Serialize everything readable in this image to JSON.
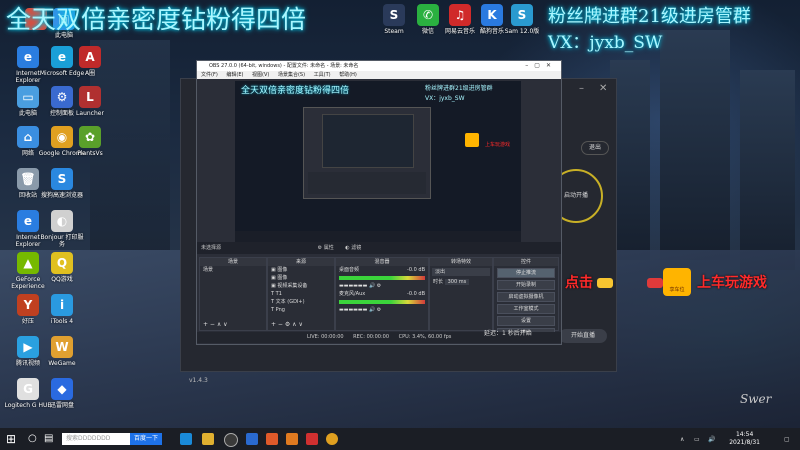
{
  "banners": {
    "main": "全天双倍亲密度钻粉得四倍",
    "top_right": "粉丝牌进群21级进房管群",
    "vx": "VX：jyxb_SW",
    "promo_prefix": "点击",
    "promo_suffix": "上车玩游戏",
    "coupon": "享车位"
  },
  "desktop_icons": [
    {
      "label": "",
      "color": "#e04a3a",
      "glyph": ""
    },
    {
      "label": "此电脑",
      "color": "#3c8ee8",
      "glyph": "▣"
    },
    {
      "label": "Internet Explorer",
      "color": "#2a7de0",
      "glyph": "e"
    },
    {
      "label": "Microsoft Edge",
      "color": "#1a9fd8",
      "glyph": "e"
    },
    {
      "label": "A圈",
      "color": "#c02a2a",
      "glyph": "A"
    },
    {
      "label": "此电脑",
      "color": "#4a9ee0",
      "glyph": "▭"
    },
    {
      "label": "控制面板",
      "color": "#3a6ad0",
      "glyph": "⚙"
    },
    {
      "label": "Launcher",
      "color": "#b03030",
      "glyph": "L"
    },
    {
      "label": "网络",
      "color": "#3a8ee0",
      "glyph": "⌂"
    },
    {
      "label": "Google Chrome",
      "color": "#e0a020",
      "glyph": "◉"
    },
    {
      "label": "PlantsVs",
      "color": "#5aa02a",
      "glyph": "✿"
    },
    {
      "label": "回收站",
      "color": "#8a9aaa",
      "glyph": "🗑"
    },
    {
      "label": "搜狗高速浏览器",
      "color": "#2a88e0",
      "glyph": "S"
    },
    {
      "label": "Internet Explorer",
      "color": "#2a7de0",
      "glyph": "e"
    },
    {
      "label": "Bonjour 打印服务",
      "color": "#d0d0d0",
      "glyph": "◐"
    },
    {
      "label": "GeForce Experience",
      "color": "#76b900",
      "glyph": "▲"
    },
    {
      "label": "QQ游戏",
      "color": "#e0c020",
      "glyph": "Q"
    },
    {
      "label": "好压",
      "color": "#c04020",
      "glyph": "Y"
    },
    {
      "label": "iTools 4",
      "color": "#2a9ae0",
      "glyph": "i"
    },
    {
      "label": "腾讯视频",
      "color": "#2aa0e0",
      "glyph": "▶"
    },
    {
      "label": "WeGame",
      "color": "#e0a030",
      "glyph": "W"
    },
    {
      "label": "Logitech G HUB",
      "color": "#e0e0e0",
      "glyph": "G"
    },
    {
      "label": "迅雷网盘",
      "color": "#2a6ae0",
      "glyph": "◆"
    }
  ],
  "top_icons": [
    {
      "label": "Steam",
      "color": "#2a3a5a",
      "glyph": "S"
    },
    {
      "label": "微信",
      "color": "#2ab040",
      "glyph": "✆"
    },
    {
      "label": "网易云音乐",
      "color": "#d02a2a",
      "glyph": "♫"
    },
    {
      "label": "酷狗音乐",
      "color": "#2a7ae0",
      "glyph": "K"
    },
    {
      "label": "Sam 12.0版",
      "color": "#2a9ad0",
      "glyph": "S"
    }
  ],
  "bg_app": {
    "exit_label": "退出",
    "start_label": "启动开播",
    "bottom_text": "开始直播",
    "version": "v1.4.3"
  },
  "obs": {
    "title": "OBS 27.0.0 (64-bit, windows) - 配置文件: 未命名 - 场景: 未命名",
    "menu": [
      "文件(F)",
      "编辑(E)",
      "视图(V)",
      "场景集合(S)",
      "工具(T)",
      "帮助(H)"
    ],
    "scene_bar": {
      "left": "未选择源",
      "properties": "属性",
      "filters": "滤镜"
    },
    "docks": {
      "scenes": {
        "title": "场景",
        "items": [
          "场景"
        ]
      },
      "sources": {
        "title": "来源",
        "items": [
          "图像",
          "图像",
          "视频采集设备",
          "T1",
          "文本 (GDI+)",
          "Png"
        ]
      },
      "mixer": {
        "title": "混音器",
        "tracks": [
          {
            "name": "桌面音频",
            "level": "-0.0 dB"
          },
          {
            "name": "麦克风/Aux",
            "level": "-0.0 dB"
          }
        ]
      },
      "transitions": {
        "title": "转场特效",
        "type": "淡出",
        "duration_label": "时长",
        "duration": "300 ms"
      },
      "controls": {
        "title": "控件",
        "buttons": [
          "停止推流",
          "开始录制",
          "启动虚拟摄像机",
          "工作室模式",
          "设置",
          "退出"
        ]
      }
    },
    "status": [
      "LIVE: 00:00:00",
      "REC: 00:00:00",
      "CPU: 3.4%, 60.00 fps"
    ],
    "status_delay": "延迟：1 秒后开始"
  },
  "taskbar": {
    "search_placeholder": "搜索DDDDDDD",
    "search_button": "百度一下",
    "time": "14:54",
    "date": "2021/8/31"
  },
  "signature": "Swer"
}
